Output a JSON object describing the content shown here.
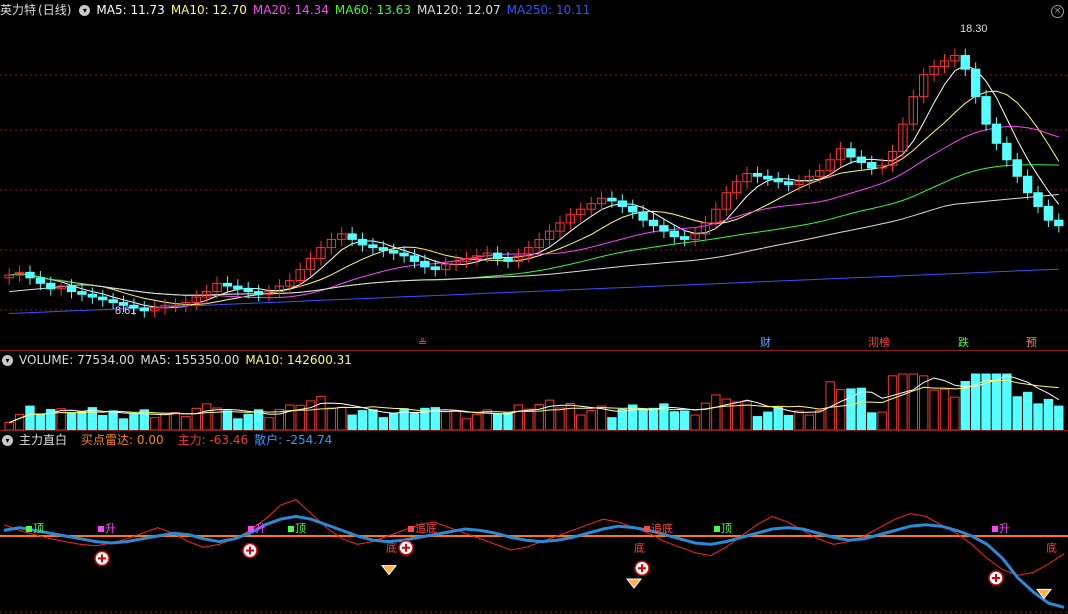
{
  "stock": {
    "name": "英力特",
    "period": "(日线)"
  },
  "main_header": {
    "ma": [
      {
        "label": "MA5: 11.73",
        "color": "#ffffff"
      },
      {
        "label": "MA10: 12.70",
        "color": "#ffff66"
      },
      {
        "label": "MA20: 14.34",
        "color": "#ff44ff"
      },
      {
        "label": "MA60: 13.63",
        "color": "#33ff33"
      },
      {
        "label": "MA120: 12.07",
        "color": "#dddddd"
      },
      {
        "label": "MA250: 10.11",
        "color": "#3355ff"
      }
    ]
  },
  "price_labels": {
    "high": "18.30",
    "low": "8.61"
  },
  "event_tags": [
    {
      "text": "≗",
      "color": "#ff4444"
    },
    {
      "text": "财",
      "color": "#66aaff"
    },
    {
      "text": "沏榜",
      "color": "#ff4444"
    },
    {
      "text": "跌",
      "color": "#44ff44"
    },
    {
      "text": "预",
      "color": "#ff8844"
    }
  ],
  "volume_header": {
    "title": "VOLUME: 77534.00",
    "ma5": "MA5: 155350.00",
    "ma10": "MA10: 142600.31"
  },
  "indicator_header": {
    "name": "主力直白",
    "buy": "买点雷达: 0.00",
    "main_force": "主力: -63.46",
    "retail": "散户: -254.74"
  },
  "signal_labels": {
    "top": "顶",
    "up": "升",
    "bottom": "底",
    "chasing_bottom": "追底"
  },
  "colors": {
    "up": "#ff3333",
    "down": "#55ffff",
    "grid": "#8a1a1a",
    "main_force_line": "#ff2222",
    "retail_line": "#2a8ad8",
    "zero_line": "#ff7a00"
  },
  "chart_data": {
    "type": "candlestick",
    "price_axis": {
      "min": 8.0,
      "max": 19.0
    },
    "closes": [
      10.0,
      10.1,
      9.9,
      9.7,
      9.5,
      9.6,
      9.4,
      9.3,
      9.2,
      9.1,
      9.0,
      8.9,
      8.8,
      8.7,
      8.8,
      8.9,
      8.9,
      9.0,
      9.2,
      9.4,
      9.7,
      9.6,
      9.5,
      9.4,
      9.3,
      9.4,
      9.6,
      9.8,
      10.2,
      10.6,
      11.0,
      11.3,
      11.5,
      11.3,
      11.1,
      11.0,
      10.9,
      10.8,
      10.7,
      10.5,
      10.3,
      10.2,
      10.4,
      10.5,
      10.6,
      10.7,
      10.8,
      10.6,
      10.5,
      10.7,
      11.0,
      11.3,
      11.6,
      11.9,
      12.2,
      12.4,
      12.6,
      12.8,
      12.7,
      12.5,
      12.3,
      12.0,
      11.8,
      11.6,
      11.4,
      11.3,
      11.5,
      11.9,
      12.4,
      13.0,
      13.4,
      13.7,
      13.6,
      13.5,
      13.4,
      13.3,
      13.4,
      13.6,
      13.8,
      14.2,
      14.6,
      14.3,
      14.1,
      13.9,
      14.0,
      14.5,
      15.5,
      16.5,
      17.3,
      17.6,
      17.8,
      18.0,
      17.5,
      16.5,
      15.5,
      14.8,
      14.2,
      13.6,
      13.0,
      12.5,
      12.0,
      11.8
    ],
    "ma_lines": [
      "MA5",
      "MA10",
      "MA20",
      "MA60",
      "MA120",
      "MA250"
    ],
    "volume_axis": {
      "max": 300000
    },
    "indicator": {
      "main_force": [
        40,
        20,
        5,
        -10,
        -20,
        -30,
        -35,
        -25,
        -10,
        10,
        30,
        10,
        -20,
        -40,
        -30,
        -10,
        20,
        60,
        110,
        130,
        80,
        30,
        -10,
        -30,
        -20,
        0,
        20,
        40,
        50,
        30,
        10,
        -10,
        -30,
        -50,
        -40,
        -20,
        0,
        20,
        40,
        60,
        50,
        30,
        10,
        -20,
        -40,
        -60,
        -70,
        -40,
        0,
        40,
        70,
        50,
        20,
        -10,
        -30,
        -20,
        0,
        30,
        60,
        80,
        70,
        40,
        10,
        -30,
        -80,
        -120,
        -140,
        -130,
        -100,
        -63.46
      ],
      "retail": [
        20,
        30,
        20,
        10,
        0,
        -10,
        -20,
        -25,
        -20,
        -10,
        0,
        10,
        5,
        -10,
        -20,
        -10,
        10,
        40,
        60,
        70,
        60,
        40,
        20,
        0,
        -15,
        -20,
        -15,
        -5,
        5,
        15,
        25,
        20,
        10,
        -5,
        -15,
        -20,
        -15,
        -5,
        10,
        25,
        35,
        30,
        20,
        5,
        -10,
        -25,
        -30,
        -20,
        -5,
        10,
        25,
        30,
        25,
        10,
        -5,
        -15,
        -10,
        5,
        20,
        35,
        40,
        35,
        20,
        0,
        -30,
        -80,
        -150,
        -200,
        -240,
        -254.74
      ]
    }
  }
}
